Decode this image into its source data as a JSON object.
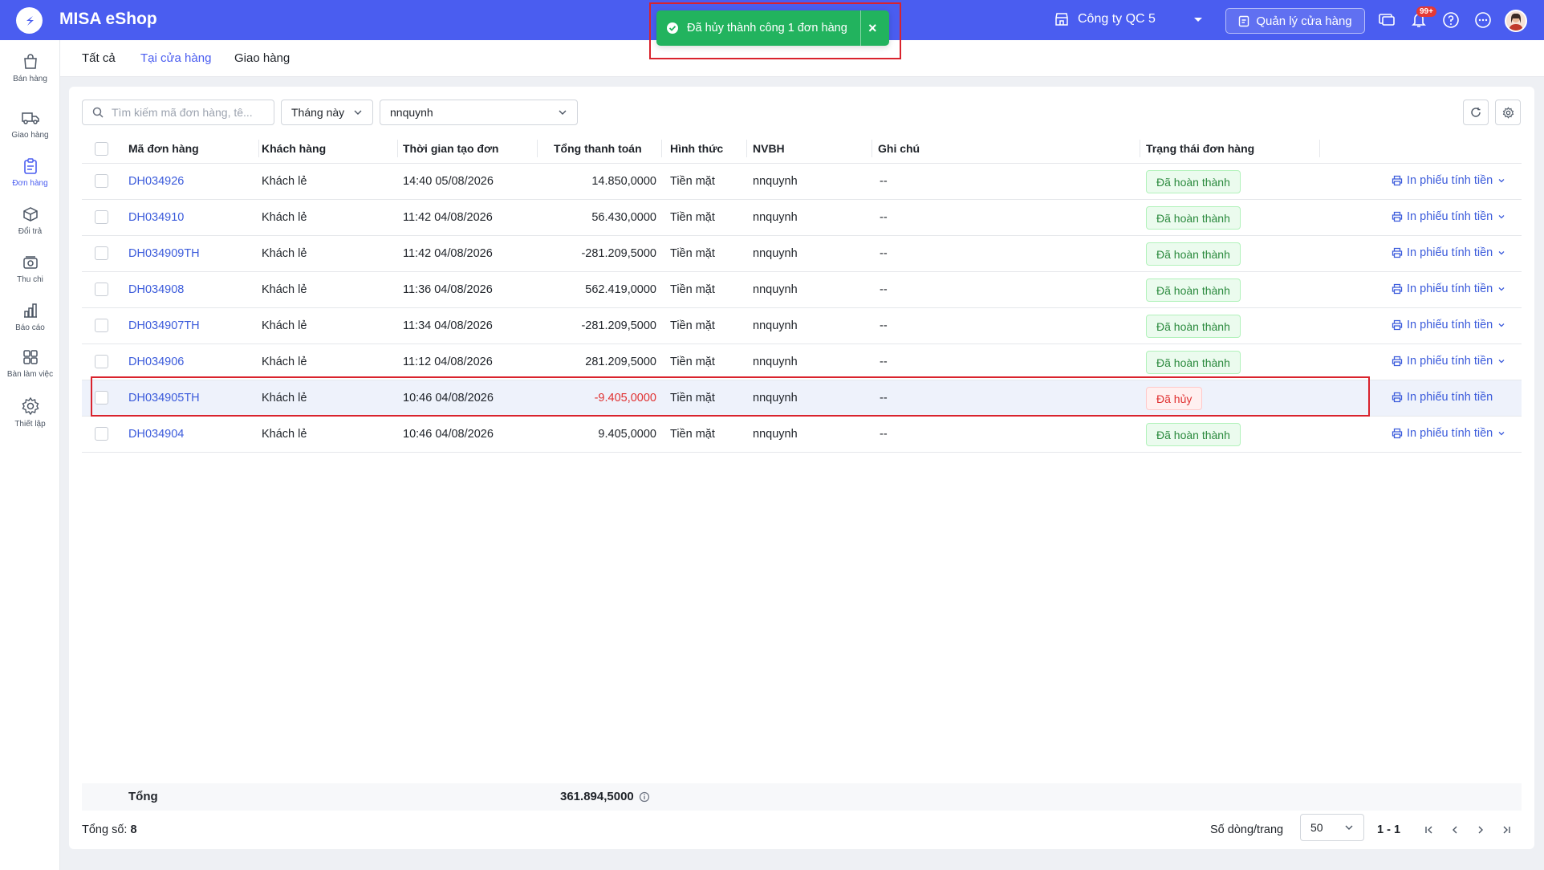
{
  "app": {
    "title": "MISA eShop",
    "brand_color": "#4a5df0"
  },
  "topbar": {
    "store_name": "Công ty QC 5",
    "manage_label": "Quản lý cửa hàng",
    "notification_count": "99+"
  },
  "toast": {
    "message": "Đã hủy thành công 1 đơn hàng",
    "close": "×"
  },
  "sidebar": {
    "items": [
      {
        "label": "Bán hàng",
        "icon": "shopping-bag-icon"
      },
      {
        "label": "Giao hàng",
        "icon": "truck-icon"
      },
      {
        "label": "Đơn hàng",
        "icon": "clipboard-icon",
        "active": true
      },
      {
        "label": "Đổi trả",
        "icon": "box-return-icon"
      },
      {
        "label": "Thu chi",
        "icon": "cash-icon"
      },
      {
        "label": "Báo cáo",
        "icon": "bar-chart-icon"
      },
      {
        "label": "Bàn làm việc",
        "icon": "grid-icon"
      },
      {
        "label": "Thiết lập",
        "icon": "gear-icon"
      }
    ]
  },
  "tabs": [
    {
      "label": "Tất cả"
    },
    {
      "label": "Tại cửa hàng",
      "active": true
    },
    {
      "label": "Giao hàng"
    }
  ],
  "filters": {
    "search_placeholder": "Tìm kiếm mã đơn hàng, tê...",
    "period": "Tháng này",
    "employee": "nnquynh"
  },
  "table": {
    "columns": [
      "Mã đơn hàng",
      "Khách hàng",
      "Thời gian tạo đơn",
      "Tổng thanh toán",
      "Hình thức",
      "NVBH",
      "Ghi chú",
      "Trạng thái đơn hàng"
    ],
    "rows": [
      {
        "code": "DH034926",
        "customer": "Khách lẻ",
        "time": "14:40 05/08/2026",
        "total": "14.850,0000",
        "method": "Tiền mặt",
        "staff": "nnquynh",
        "note": "--",
        "status": "Đã hoàn thành",
        "action": "In phiếu tính tiền"
      },
      {
        "code": "DH034910",
        "customer": "Khách lẻ",
        "time": "11:42 04/08/2026",
        "total": "56.430,0000",
        "method": "Tiền mặt",
        "staff": "nnquynh",
        "note": "--",
        "status": "Đã hoàn thành",
        "action": "In phiếu tính tiền"
      },
      {
        "code": "DH034909TH",
        "customer": "Khách lẻ",
        "time": "11:42 04/08/2026",
        "total": "-281.209,5000",
        "method": "Tiền mặt",
        "staff": "nnquynh",
        "note": "--",
        "status": "Đã hoàn thành",
        "action": "In phiếu tính tiền"
      },
      {
        "code": "DH034908",
        "customer": "Khách lẻ",
        "time": "11:36 04/08/2026",
        "total": "562.419,0000",
        "method": "Tiền mặt",
        "staff": "nnquynh",
        "note": "--",
        "status": "Đã hoàn thành",
        "action": "In phiếu tính tiền"
      },
      {
        "code": "DH034907TH",
        "customer": "Khách lẻ",
        "time": "11:34 04/08/2026",
        "total": "-281.209,5000",
        "method": "Tiền mặt",
        "staff": "nnquynh",
        "note": "--",
        "status": "Đã hoàn thành",
        "action": "In phiếu tính tiền"
      },
      {
        "code": "DH034906",
        "customer": "Khách lẻ",
        "time": "11:12 04/08/2026",
        "total": "281.209,5000",
        "method": "Tiền mặt",
        "staff": "nnquynh",
        "note": "--",
        "status": "Đã hoàn thành",
        "action": "In phiếu tính tiền"
      },
      {
        "code": "DH034905TH",
        "customer": "Khách lẻ",
        "time": "10:46 04/08/2026",
        "total": "-9.405,0000",
        "method": "Tiền mặt",
        "staff": "nnquynh",
        "note": "--",
        "status": "Đã hủy",
        "action": "In phiếu tính tiền"
      },
      {
        "code": "DH034904",
        "customer": "Khách lẻ",
        "time": "10:46 04/08/2026",
        "total": "9.405,0000",
        "method": "Tiền mặt",
        "staff": "nnquynh",
        "note": "--",
        "status": "Đã hoàn thành",
        "action": "In phiếu tính tiền"
      }
    ]
  },
  "summary": {
    "label": "Tổng",
    "total": "361.894,5000"
  },
  "pagination": {
    "total_label": "Tổng số:",
    "total_count": "8",
    "rows_per_page_label": "Số dòng/trang",
    "rows_per_page": "50",
    "range": "1 - 1"
  }
}
